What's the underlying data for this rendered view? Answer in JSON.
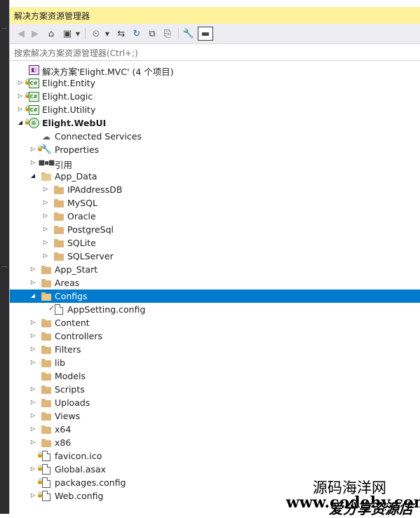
{
  "panel": {
    "title": "解决方案资源管理器",
    "search_placeholder": "搜索解决方案资源管理器(Ctrl+;)"
  },
  "toolbar": {
    "buttons": [
      "back-icon",
      "forward-icon",
      "home-icon",
      "switch-views-icon",
      "dropdown-icon",
      "pending-changes-icon",
      "dropdown-icon",
      "sync-icon",
      "refresh-icon",
      "collapse-all-icon",
      "show-all-files-icon",
      "properties-icon",
      "preview-icon"
    ]
  },
  "tree": [
    {
      "label": "解决方案'Elight.MVC' (4 个项目)",
      "icon": "solution-icon",
      "level": 0,
      "expander": "none",
      "bold": false,
      "locked": false
    },
    {
      "label": "Elight.Entity",
      "icon": "csharp-project-icon",
      "level": 0,
      "expander": "collapsed",
      "bold": false,
      "locked": true
    },
    {
      "label": "Elight.Logic",
      "icon": "csharp-project-icon",
      "level": 0,
      "expander": "collapsed",
      "bold": false,
      "locked": true
    },
    {
      "label": "Elight.Utility",
      "icon": "csharp-project-icon",
      "level": 0,
      "expander": "collapsed",
      "bold": false,
      "locked": true
    },
    {
      "label": "Elight.WebUI",
      "icon": "web-project-icon",
      "level": 0,
      "expander": "expanded",
      "bold": true,
      "locked": true
    },
    {
      "label": "Connected Services",
      "icon": "connected-services-icon",
      "level": 1,
      "expander": "none",
      "bold": false,
      "locked": false
    },
    {
      "label": "Properties",
      "icon": "wrench-icon",
      "level": 1,
      "expander": "collapsed",
      "bold": false,
      "locked": true
    },
    {
      "label": "引用",
      "icon": "references-icon",
      "level": 1,
      "expander": "collapsed",
      "bold": false,
      "locked": false
    },
    {
      "label": "App_Data",
      "icon": "folder-open-icon",
      "level": 1,
      "expander": "expanded",
      "bold": false,
      "locked": false
    },
    {
      "label": "IPAddressDB",
      "icon": "folder-icon",
      "level": 2,
      "expander": "collapsed",
      "bold": false,
      "locked": false
    },
    {
      "label": "MySQL",
      "icon": "folder-icon",
      "level": 2,
      "expander": "collapsed",
      "bold": false,
      "locked": false
    },
    {
      "label": "Oracle",
      "icon": "folder-icon",
      "level": 2,
      "expander": "collapsed",
      "bold": false,
      "locked": false
    },
    {
      "label": "PostgreSql",
      "icon": "folder-icon",
      "level": 2,
      "expander": "collapsed",
      "bold": false,
      "locked": false
    },
    {
      "label": "SQLite",
      "icon": "folder-icon",
      "level": 2,
      "expander": "collapsed",
      "bold": false,
      "locked": false
    },
    {
      "label": "SQLServer",
      "icon": "folder-icon",
      "level": 2,
      "expander": "collapsed",
      "bold": false,
      "locked": false
    },
    {
      "label": "App_Start",
      "icon": "folder-icon",
      "level": 1,
      "expander": "collapsed",
      "bold": false,
      "locked": false
    },
    {
      "label": "Areas",
      "icon": "folder-icon",
      "level": 1,
      "expander": "collapsed",
      "bold": false,
      "locked": false
    },
    {
      "label": "Configs",
      "icon": "folder-open-icon",
      "level": 1,
      "expander": "expanded",
      "bold": false,
      "locked": false,
      "selected": true
    },
    {
      "label": "AppSetting.config",
      "icon": "config-file-icon",
      "level": 2,
      "expander": "none",
      "bold": false,
      "locked": false,
      "checked_out": true
    },
    {
      "label": "Content",
      "icon": "folder-icon",
      "level": 1,
      "expander": "collapsed",
      "bold": false,
      "locked": false
    },
    {
      "label": "Controllers",
      "icon": "folder-icon",
      "level": 1,
      "expander": "collapsed",
      "bold": false,
      "locked": false
    },
    {
      "label": "Filters",
      "icon": "folder-icon",
      "level": 1,
      "expander": "collapsed",
      "bold": false,
      "locked": false
    },
    {
      "label": "lib",
      "icon": "folder-icon",
      "level": 1,
      "expander": "collapsed",
      "bold": false,
      "locked": false
    },
    {
      "label": "Models",
      "icon": "folder-icon",
      "level": 1,
      "expander": "none",
      "bold": false,
      "locked": false
    },
    {
      "label": "Scripts",
      "icon": "folder-icon",
      "level": 1,
      "expander": "collapsed",
      "bold": false,
      "locked": false
    },
    {
      "label": "Uploads",
      "icon": "folder-icon",
      "level": 1,
      "expander": "collapsed",
      "bold": false,
      "locked": false
    },
    {
      "label": "Views",
      "icon": "folder-icon",
      "level": 1,
      "expander": "collapsed",
      "bold": false,
      "locked": false
    },
    {
      "label": "x64",
      "icon": "folder-icon",
      "level": 1,
      "expander": "collapsed",
      "bold": false,
      "locked": false
    },
    {
      "label": "x86",
      "icon": "folder-icon",
      "level": 1,
      "expander": "collapsed",
      "bold": false,
      "locked": false
    },
    {
      "label": "favicon.ico",
      "icon": "image-file-icon",
      "level": 1,
      "expander": "none",
      "bold": false,
      "locked": true
    },
    {
      "label": "Global.asax",
      "icon": "asax-file-icon",
      "level": 1,
      "expander": "collapsed",
      "bold": false,
      "locked": true
    },
    {
      "label": "packages.config",
      "icon": "config-file-icon",
      "level": 1,
      "expander": "none",
      "bold": false,
      "locked": true
    },
    {
      "label": "Web.config",
      "icon": "config-file-icon",
      "level": 1,
      "expander": "collapsed",
      "bold": false,
      "locked": true
    }
  ],
  "watermark": {
    "line1": "源码海洋网",
    "line2": "www.codehy.com",
    "line3": "爱分享资源店"
  }
}
